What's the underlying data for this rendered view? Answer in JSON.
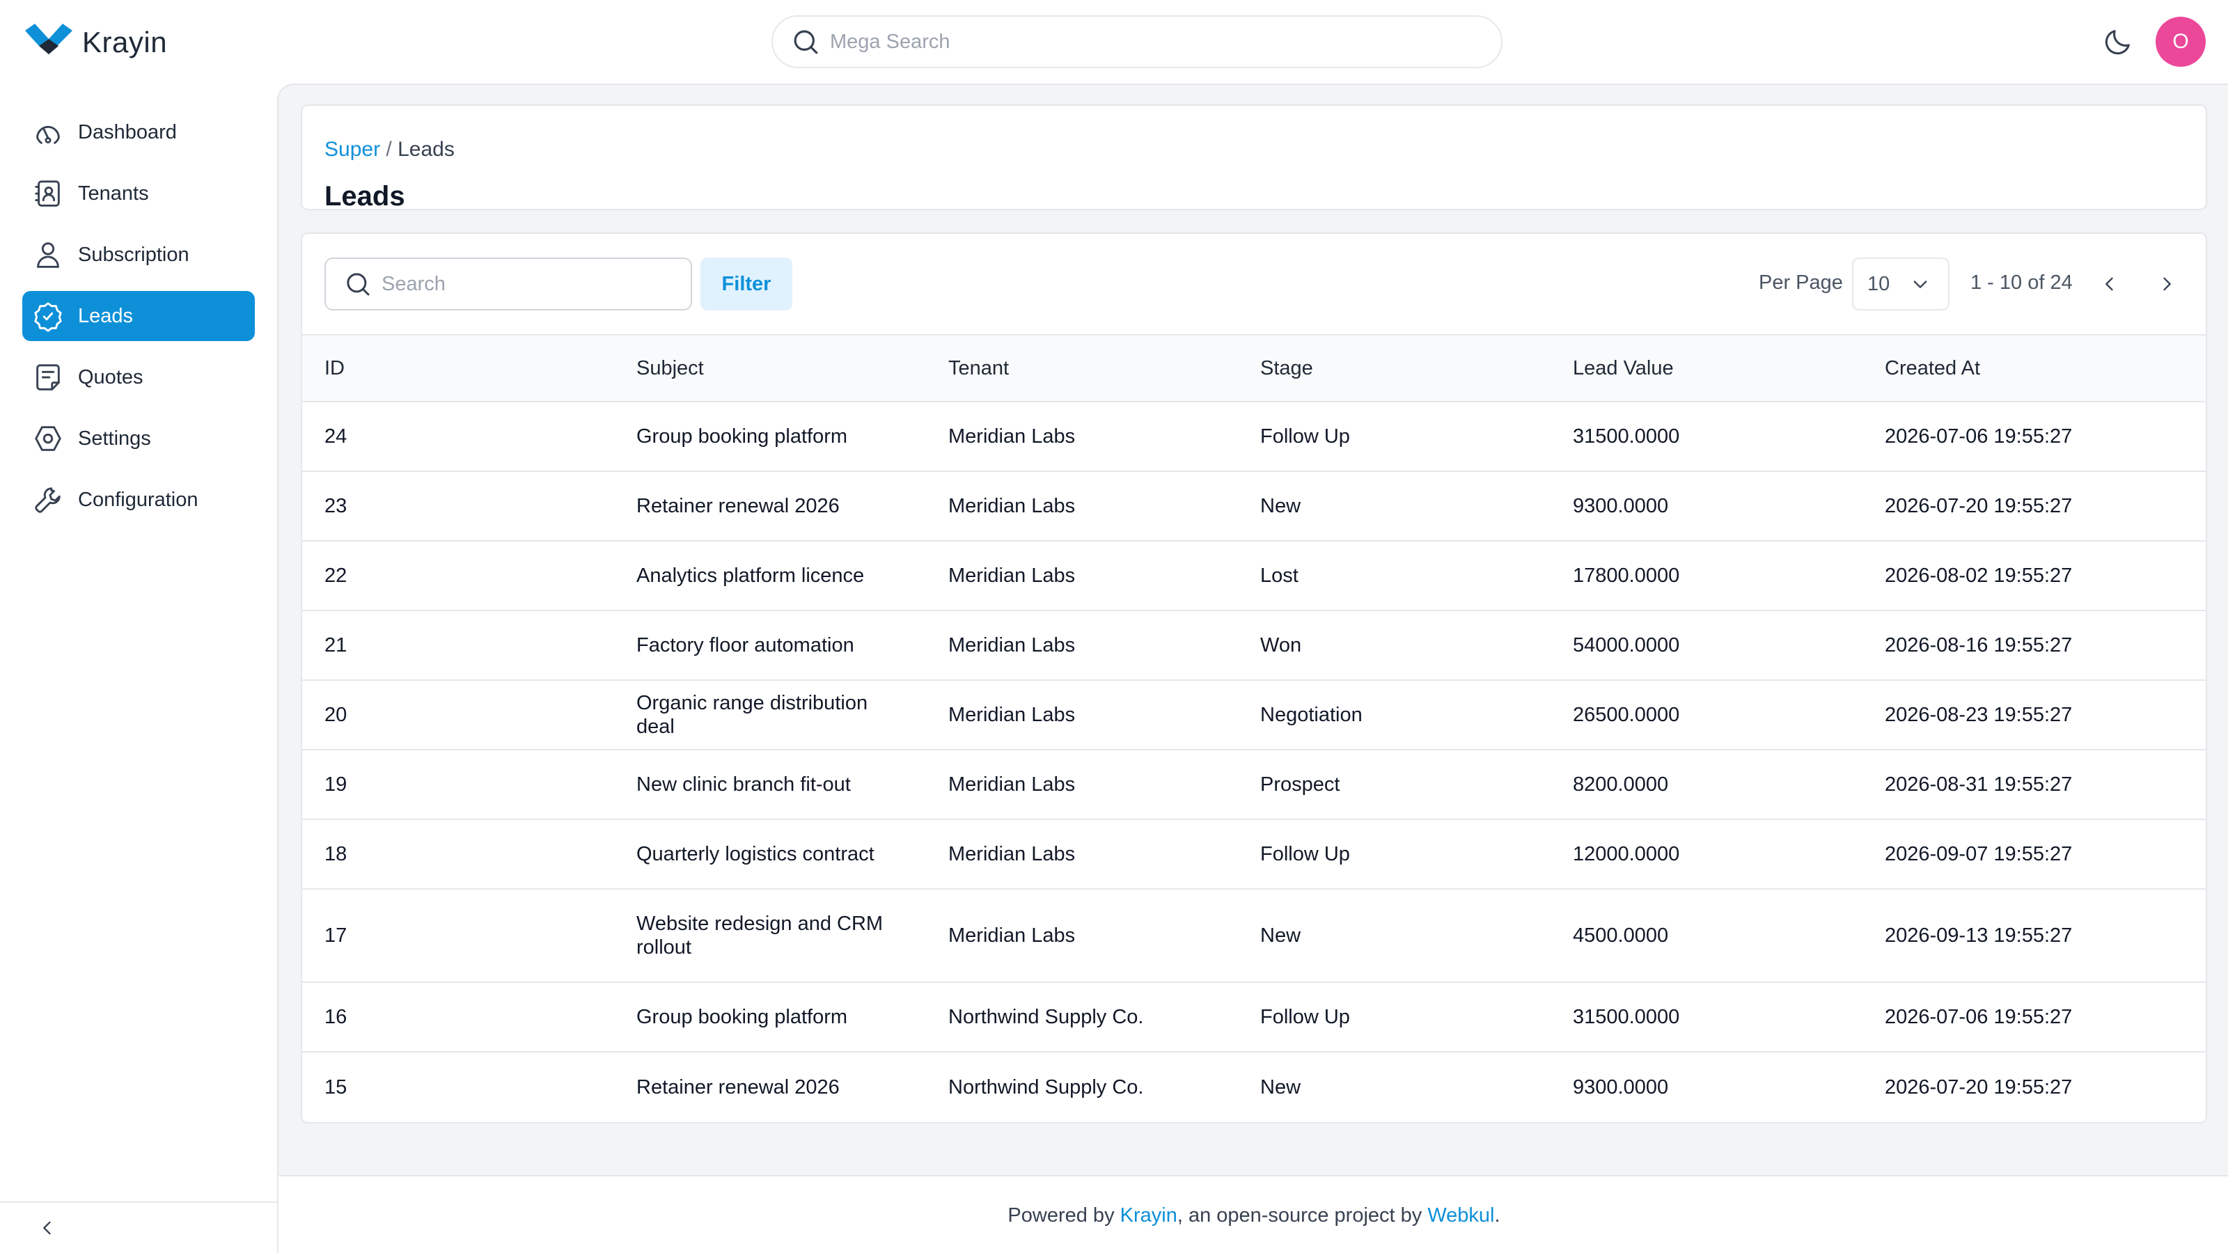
{
  "app": {
    "name": "Krayin"
  },
  "colors": {
    "accent": "#0e90d9",
    "avatar_bg": "#ec4899",
    "page_bg": "#f3f4f6"
  },
  "header": {
    "search_placeholder": "Mega Search",
    "theme_icon": "moon-icon",
    "avatar_initial": "O"
  },
  "sidebar": {
    "items": [
      {
        "label": "Dashboard",
        "icon": "dashboard-icon",
        "active": false
      },
      {
        "label": "Tenants",
        "icon": "tenants-icon",
        "active": false
      },
      {
        "label": "Subscription",
        "icon": "user-icon",
        "active": false
      },
      {
        "label": "Leads",
        "icon": "leads-icon",
        "active": true
      },
      {
        "label": "Quotes",
        "icon": "quotes-icon",
        "active": false
      },
      {
        "label": "Settings",
        "icon": "settings-icon",
        "active": false
      },
      {
        "label": "Configuration",
        "icon": "wrench-icon",
        "active": false
      }
    ],
    "collapse_icon": "chevron-left-icon"
  },
  "page": {
    "breadcrumb": {
      "parent": "Super",
      "separator": " / ",
      "current": "Leads"
    },
    "title": "Leads"
  },
  "datagrid": {
    "search_placeholder": "Search",
    "filter_label": "Filter",
    "per_page_label": "Per Page",
    "per_page_value": "10",
    "range_text": "1 - 10 of 24",
    "columns": [
      "ID",
      "Subject",
      "Tenant",
      "Stage",
      "Lead Value",
      "Created At"
    ],
    "rows": [
      [
        "24",
        "Group booking platform",
        "Meridian Labs",
        "Follow Up",
        "31500.0000",
        "2026-07-06 19:55:27"
      ],
      [
        "23",
        "Retainer renewal 2026",
        "Meridian Labs",
        "New",
        "9300.0000",
        "2026-07-20 19:55:27"
      ],
      [
        "22",
        "Analytics platform licence",
        "Meridian Labs",
        "Lost",
        "17800.0000",
        "2026-08-02 19:55:27"
      ],
      [
        "21",
        "Factory floor automation",
        "Meridian Labs",
        "Won",
        "54000.0000",
        "2026-08-16 19:55:27"
      ],
      [
        "20",
        "Organic range distribution deal",
        "Meridian Labs",
        "Negotiation",
        "26500.0000",
        "2026-08-23 19:55:27"
      ],
      [
        "19",
        "New clinic branch fit-out",
        "Meridian Labs",
        "Prospect",
        "8200.0000",
        "2026-08-31 19:55:27"
      ],
      [
        "18",
        "Quarterly logistics contract",
        "Meridian Labs",
        "Follow Up",
        "12000.0000",
        "2026-09-07 19:55:27"
      ],
      [
        "17",
        "Website redesign and CRM rollout",
        "Meridian Labs",
        "New",
        "4500.0000",
        "2026-09-13 19:55:27"
      ],
      [
        "16",
        "Group booking platform",
        "Northwind Supply Co.",
        "Follow Up",
        "31500.0000",
        "2026-07-06 19:55:27"
      ],
      [
        "15",
        "Retainer renewal 2026",
        "Northwind Supply Co.",
        "New",
        "9300.0000",
        "2026-07-20 19:55:27"
      ]
    ]
  },
  "footer": {
    "prefix": "Powered by ",
    "link1": "Krayin",
    "middle": ", an open-source project by ",
    "link2": "Webkul",
    "suffix": "."
  }
}
